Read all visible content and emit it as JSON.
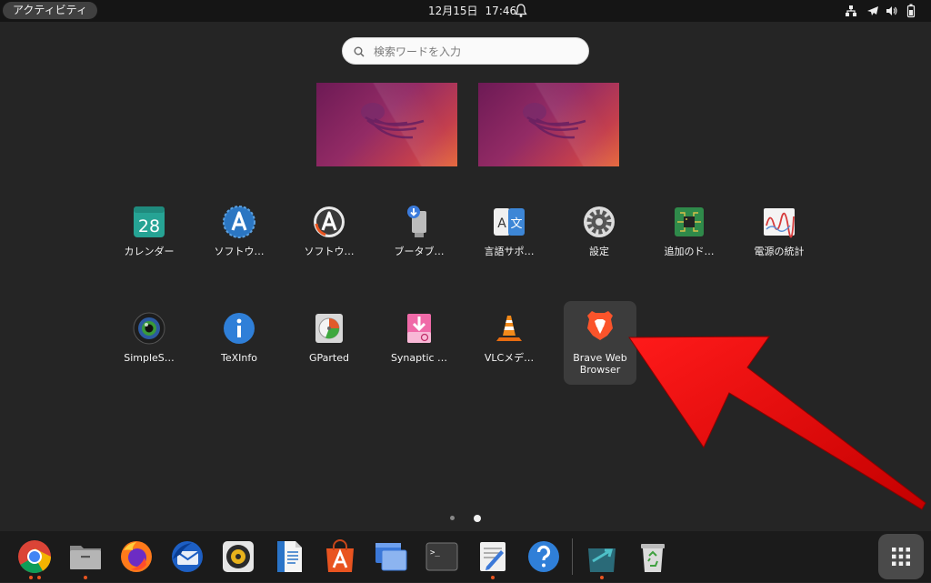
{
  "topbar": {
    "activities": "アクティビティ",
    "date": "12月15日",
    "time": "17:46",
    "icons": [
      "bell-icon",
      "network-icon",
      "airplane-icon",
      "volume-icon",
      "battery-icon"
    ]
  },
  "search": {
    "placeholder": "検索ワードを入力"
  },
  "workspaces": [
    "workspace-1",
    "workspace-2"
  ],
  "apps": {
    "row1": [
      {
        "label": "カレンダー",
        "icon_text": "28"
      },
      {
        "label": "ソフトウ…"
      },
      {
        "label": "ソフトウ…"
      },
      {
        "label": "ブータブ…"
      },
      {
        "label": "言語サポ…",
        "icon_text_a": "A",
        "icon_text_b": "文"
      },
      {
        "label": "設定"
      },
      {
        "label": "追加のド…"
      },
      {
        "label": "電源の統計"
      }
    ],
    "row2": [
      {
        "label": "SimpleS…"
      },
      {
        "label": "TeXInfo"
      },
      {
        "label": "GParted"
      },
      {
        "label": "Synaptic …"
      },
      {
        "label": "VLCメデ…"
      },
      {
        "label": "Brave Web Browser"
      }
    ]
  },
  "pages": {
    "count": 2,
    "current": 2
  },
  "dock": {
    "items": [
      "Google Chrome",
      "Files",
      "Firefox",
      "Thunderbird",
      "Rhythmbox",
      "LibreOffice Writer",
      "Ubuntu Software",
      "Workspaces",
      "Terminal",
      "Text Editor",
      "Help",
      "Synaptic",
      "Trash"
    ],
    "terminal_prompt": ">_"
  },
  "colors": {
    "accent": "#e95420",
    "arrow": "#e00000",
    "background": "#252525"
  }
}
